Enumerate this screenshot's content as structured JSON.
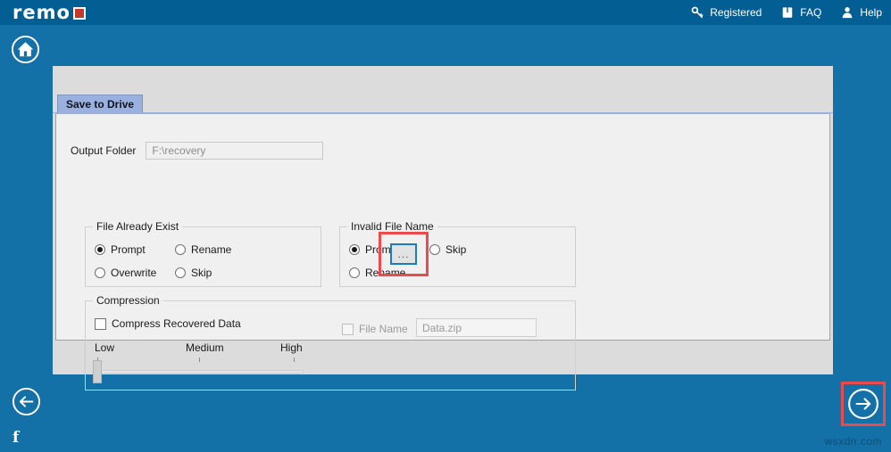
{
  "brand": {
    "name": "remo",
    "accent_color": "#c0392b",
    "topbar_color": "#035e93",
    "body_color": "#1471a8"
  },
  "topnav": {
    "items": [
      {
        "label": "Registered",
        "icon": "key-icon"
      },
      {
        "label": "FAQ",
        "icon": "book-icon"
      },
      {
        "label": "Help",
        "icon": "person-icon"
      }
    ]
  },
  "home": {
    "icon": "home-icon"
  },
  "panel": {
    "tab": {
      "label": "Save to Drive",
      "active": true
    },
    "output": {
      "label": "Output Folder",
      "value": "F:\\recovery",
      "placeholder": "F:\\recovery",
      "browse_label": "...",
      "browse_highlight_color": "#eb4b4b",
      "browse_focus_color": "#1a7dc4"
    },
    "file_exist_group": {
      "title": "File Already Exist",
      "options": [
        {
          "label": "Prompt",
          "selected": true
        },
        {
          "label": "Rename",
          "selected": false
        },
        {
          "label": "Overwrite",
          "selected": false
        },
        {
          "label": "Skip",
          "selected": false
        }
      ]
    },
    "invalid_name_group": {
      "title": "Invalid File Name",
      "options": [
        {
          "label": "Prompt",
          "selected": true
        },
        {
          "label": "Skip",
          "selected": false
        },
        {
          "label": "Rename",
          "selected": false
        }
      ]
    },
    "compression_group": {
      "title": "Compression",
      "compress_checkbox": {
        "label": "Compress Recovered Data",
        "checked": false
      },
      "slider": {
        "labels": [
          "Low",
          "Medium",
          "High"
        ],
        "value": "Low",
        "position_percent": 0
      },
      "file_name_checkbox": {
        "label": "File Name",
        "checked": false,
        "disabled": true
      },
      "file_name_input": {
        "value": "Data.zip",
        "placeholder": "Data.zip",
        "disabled": true
      }
    }
  },
  "footer": {
    "back": {
      "icon": "arrow-left-circle-icon",
      "label": "Back"
    },
    "next": {
      "icon": "arrow-right-circle-icon",
      "label": "Next",
      "highlight_color": "#eb4b4b"
    },
    "facebook": {
      "icon": "facebook-icon",
      "label": "f"
    },
    "watermark": "wsxdn.com"
  }
}
